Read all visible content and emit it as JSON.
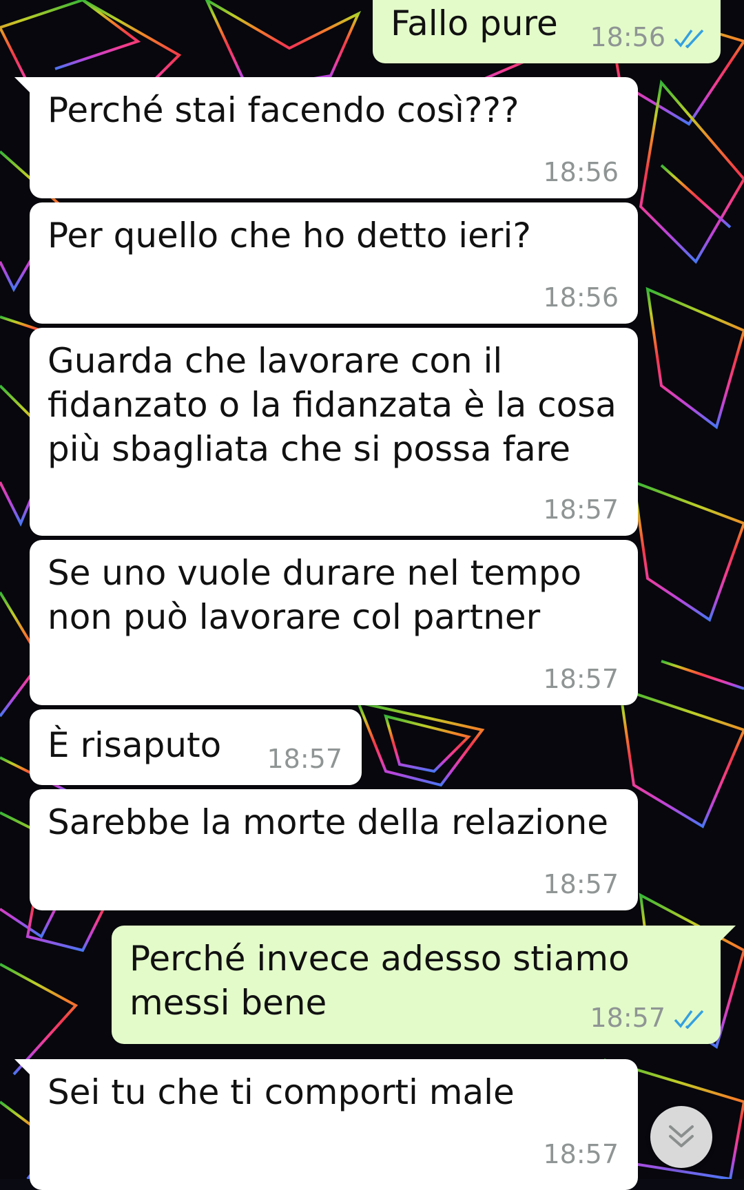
{
  "colors": {
    "incoming_bubble": "#ffffff",
    "outgoing_bubble": "#e3fbc9",
    "timestamp": "#8f9594",
    "read_ticks": "#34a0e0"
  },
  "messages": [
    {
      "direction": "outgoing",
      "text": "Fallo pure",
      "time": "18:56",
      "status": "read"
    },
    {
      "direction": "incoming",
      "text": "Perché stai facendo così???",
      "time": "18:56"
    },
    {
      "direction": "incoming",
      "text": "Per quello che ho detto ieri?",
      "time": "18:56"
    },
    {
      "direction": "incoming",
      "text": "Guarda che lavorare con il fidanzato o la fidanzata è la cosa più sbagliata che si possa fare",
      "time": "18:57"
    },
    {
      "direction": "incoming",
      "text": "Se uno vuole durare nel tempo non può lavorare col partner",
      "time": "18:57"
    },
    {
      "direction": "incoming",
      "text": "È risaputo",
      "time": "18:57"
    },
    {
      "direction": "incoming",
      "text": "Sarebbe la morte della relazione",
      "time": "18:57"
    },
    {
      "direction": "outgoing",
      "text": "Perché invece adesso stiamo messi bene",
      "time": "18:57",
      "status": "read"
    },
    {
      "direction": "incoming",
      "text": "Sei tu che ti comporti male",
      "time": "18:57"
    }
  ],
  "scroll_to_bottom_icon": "double-chevron-down-icon"
}
